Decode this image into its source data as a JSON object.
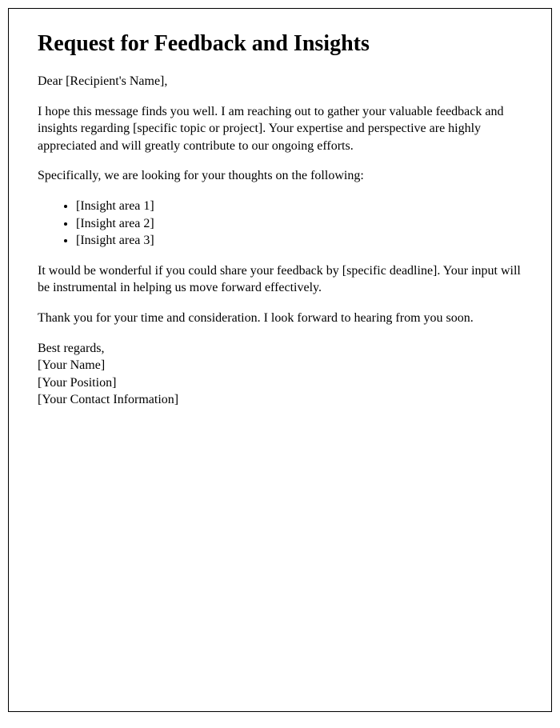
{
  "title": "Request for Feedback and Insights",
  "salutation": "Dear [Recipient's Name],",
  "paragraph1": "I hope this message finds you well. I am reaching out to gather your valuable feedback and insights regarding [specific topic or project]. Your expertise and perspective are highly appreciated and will greatly contribute to our ongoing efforts.",
  "paragraph2": "Specifically, we are looking for your thoughts on the following:",
  "insights": [
    "[Insight area 1]",
    "[Insight area 2]",
    "[Insight area 3]"
  ],
  "paragraph3": "It would be wonderful if you could share your feedback by [specific deadline]. Your input will be instrumental in helping us move forward effectively.",
  "paragraph4": "Thank you for your time and consideration. I look forward to hearing from you soon.",
  "closing": "Best regards,",
  "signature": {
    "name": "[Your Name]",
    "position": "[Your Position]",
    "contact": "[Your Contact Information]"
  }
}
